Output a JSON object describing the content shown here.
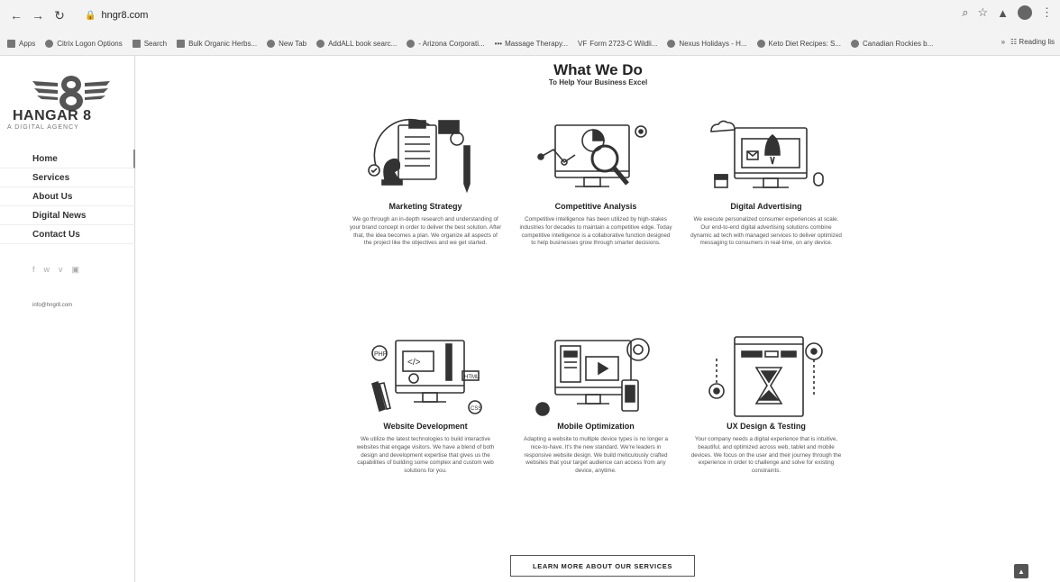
{
  "browser": {
    "url": "hngr8.com",
    "bookmarks": [
      {
        "label": "Apps",
        "icon": "apps-grid-icon"
      },
      {
        "label": "Citrix Logon Options",
        "icon": "globe-icon"
      },
      {
        "label": "Search",
        "icon": "search-bookmark-icon"
      },
      {
        "label": "Bulk Organic Herbs...",
        "icon": "herbs-icon"
      },
      {
        "label": "New Tab",
        "icon": "globe-icon"
      },
      {
        "label": "AddALL book searc...",
        "icon": "book-icon"
      },
      {
        "label": "- Arizona Corporati...",
        "icon": "globe-icon"
      },
      {
        "label": "Massage Therapy...",
        "icon": "dots-icon"
      },
      {
        "label": "Form 2723-C Wildli...",
        "icon": "form-icon"
      },
      {
        "label": "Nexus Holidays - H...",
        "icon": "globe-icon"
      },
      {
        "label": "Keto Diet Recipes: S...",
        "icon": "globe-icon"
      },
      {
        "label": "Canadian Rockies b...",
        "icon": "globe-icon"
      }
    ],
    "reading_list": "Reading lis"
  },
  "sidebar": {
    "logo_name": "HANGAR 8",
    "logo_sub": "A DIGITAL AGENCY",
    "menu": [
      "Home",
      "Services",
      "About Us",
      "Digital News",
      "Contact Us"
    ],
    "email": "info@hngr8.com"
  },
  "main": {
    "title": "What We Do",
    "subtitle": "To Help Your Business Excel",
    "services": [
      {
        "name": "Marketing Strategy",
        "text": "We go through an in-depth research and understanding of your brand concept in order to deliver the best solution. After that, the idea becomes a plan. We organize all aspects of the project like the objectives and we get started."
      },
      {
        "name": "Competitive Analysis",
        "text": "Competitive intelligence has been utilized by high-stakes industries for decades to maintain a competitive edge. Today competitive intelligence is a collaborative function designed to help businesses grow through smarter decisions."
      },
      {
        "name": "Digital Advertising",
        "text": "We execute personalized consumer experiences at scale. Our end-to-end digital advertising solutions combine dynamic ad tech with managed services to deliver optimized messaging to consumers in real-time, on any device."
      },
      {
        "name": "Website Development",
        "text": "We utilize the latest technologies to build interactive websites that engage visitors. We have a blend of both design and development expertise that gives us the capabilities of building some complex and custom web solutions for you."
      },
      {
        "name": "Mobile Optimization",
        "text": "Adapting a website to multiple device types is no longer a nice-to-have. It's the new standard. We're leaders in responsive website design. We build meticulously crafted websites that your target audience can access from any device, anytime."
      },
      {
        "name": "UX Design & Testing",
        "text": "Your company needs a digital experience that is intuitive, beautiful, and optimized across web, tablet and mobile devices. We focus on the user and their journey through the experience in order to challenge and solve for existing constraints."
      }
    ],
    "cta_label": "LEARN MORE ABOUT OUR SERVICES"
  }
}
